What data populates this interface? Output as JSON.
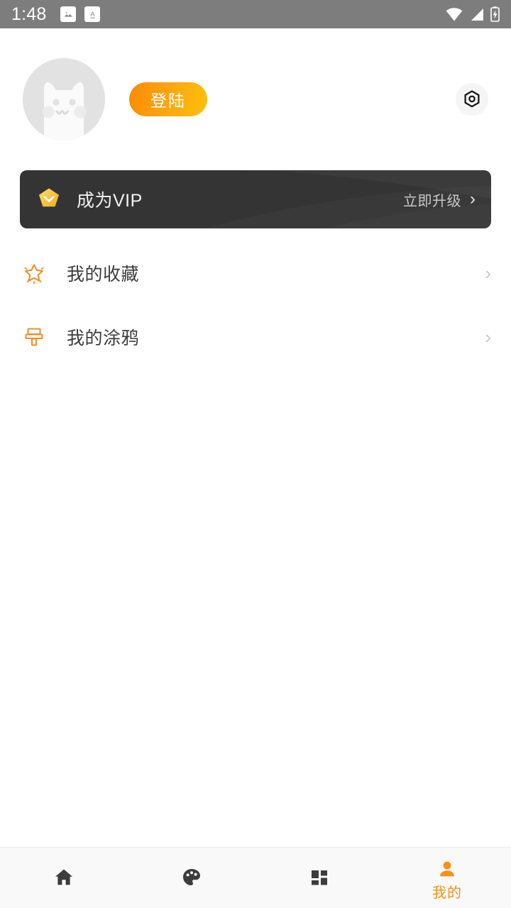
{
  "status_bar": {
    "time": "1:48",
    "left_icons": [
      "image-icon",
      "text-format-icon"
    ],
    "right_icons": [
      "wifi-icon",
      "cellular-signal-icon",
      "battery-charging-icon"
    ],
    "background_color": "#7d7d7d"
  },
  "header": {
    "avatar_icon": "cat-avatar-placeholder",
    "login_label": "登陆",
    "settings_icon": "hex-nut-settings-icon",
    "login_gradient_from": "#fb8c00",
    "login_gradient_to": "#ffc107"
  },
  "vip_banner": {
    "badge_icon": "vip-diamond-badge-icon",
    "title": "成为VIP",
    "cta_label": "立即升级",
    "chevron": "›",
    "background_color": "#343434",
    "badge_color": "#f5c340"
  },
  "menu": {
    "items": [
      {
        "icon": "star-outline-icon",
        "label": "我的收藏",
        "chevron": "›"
      },
      {
        "icon": "paint-brush-icon",
        "label": "我的涂鸦",
        "chevron": "›"
      }
    ]
  },
  "bottom_nav": {
    "active_color": "#fa9016",
    "inactive_color": "#3c3c3c",
    "items": [
      {
        "icon": "home-icon",
        "label": "",
        "active": false
      },
      {
        "icon": "palette-icon",
        "label": "",
        "active": false
      },
      {
        "icon": "grid-dashboard-icon",
        "label": "",
        "active": false
      },
      {
        "icon": "person-icon",
        "label": "我的",
        "active": true
      }
    ]
  }
}
